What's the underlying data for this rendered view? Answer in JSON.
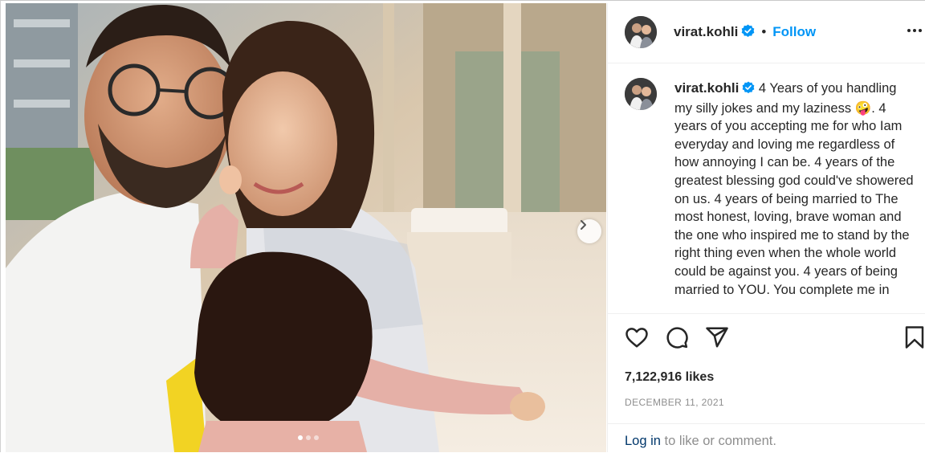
{
  "post": {
    "username": "virat.kohli",
    "verified": true,
    "follow_label": "Follow",
    "more_icon": "more-horizontal-icon",
    "caption_text": " 4 Years of you handling my silly jokes and my laziness 🤪. 4 years of you accepting me for who Iam everyday and loving me regardless of how annoying I can be. 4 years of the greatest blessing god could've showered on us. 4 years of being married to The most honest, loving, brave woman and the one who inspired me to stand by the right thing even when the whole world could be against you. 4 years of being married to YOU. You complete me in",
    "likes": "7,122,916 likes",
    "date": "DECEMBER 11, 2021",
    "login_link": "Log in",
    "login_suffix": " to like or comment."
  },
  "carousel": {
    "total": 3,
    "current": 1
  },
  "colors": {
    "accent": "#0095f6",
    "verified": "#0095f6",
    "text": "#262626",
    "muted": "#8e8e8e"
  }
}
